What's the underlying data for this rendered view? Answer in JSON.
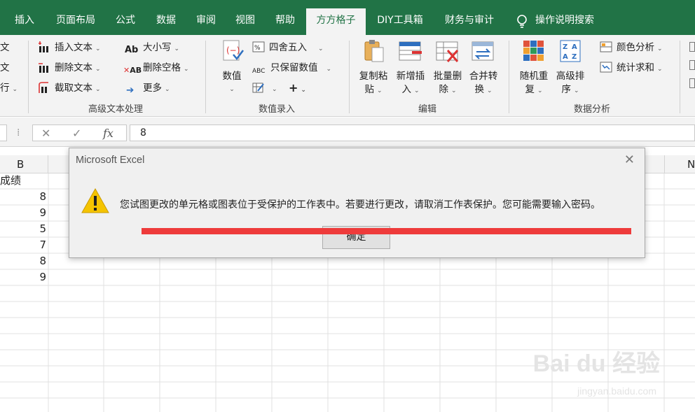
{
  "tabs": [
    {
      "label": "插入",
      "active": false
    },
    {
      "label": "页面布局",
      "active": false
    },
    {
      "label": "公式",
      "active": false
    },
    {
      "label": "数据",
      "active": false
    },
    {
      "label": "审阅",
      "active": false
    },
    {
      "label": "视图",
      "active": false
    },
    {
      "label": "帮助",
      "active": false
    },
    {
      "label": "方方格子",
      "active": true
    },
    {
      "label": "DIY工具箱",
      "active": false
    },
    {
      "label": "财务与审计",
      "active": false
    }
  ],
  "search_label": "操作说明搜索",
  "ribbon": {
    "text_group": {
      "cut_left": [
        "文",
        "文",
        "行"
      ],
      "insert_text": "插入文本",
      "delete_text": "删除文本",
      "extract_text": "截取文本",
      "case": "大小写",
      "delete_spaces": "删除空格",
      "more": "更多",
      "label": "高级文本处理"
    },
    "number_group": {
      "value_big_label": "数值",
      "round": "四舍五入",
      "keep_numbers": "只保留数值",
      "plus": "+",
      "label": "数值录入"
    },
    "edit_group": {
      "copy_paste": [
        "复制粘",
        "贴"
      ],
      "add_insert": [
        "新增插",
        "入"
      ],
      "batch_delete": [
        "批量删",
        "除"
      ],
      "merge_convert": [
        "合并转",
        "换"
      ],
      "label": "编辑"
    },
    "analysis_group": {
      "random_repeat": [
        "随机重",
        "复"
      ],
      "advanced_sort": [
        "高级排",
        "序"
      ],
      "color_analysis": "颜色分析",
      "stats_sum": "统计求和",
      "label": "数据分析"
    }
  },
  "formula_bar": {
    "cancel": "✕",
    "confirm": "✓",
    "fx": "fx",
    "value": "8"
  },
  "columns": {
    "b": "B",
    "n": "N"
  },
  "cells": {
    "header": "成绩",
    "values": [
      "8",
      "9",
      "5",
      "7",
      "8",
      "9"
    ]
  },
  "dialog": {
    "title": "Microsoft Excel",
    "message": "您试图更改的单元格或图表位于受保护的工作表中。若要进行更改，请取消工作表保护。您可能需要输入密码。",
    "ok_label": "确定",
    "close": "✕"
  },
  "watermark": {
    "main": "Bai du 经验",
    "sub": "jingyan.baidu.com"
  },
  "colors": {
    "excel_green": "#217346",
    "red_annotation": "#ee3b3b",
    "warning_yellow": "#f5c400"
  }
}
